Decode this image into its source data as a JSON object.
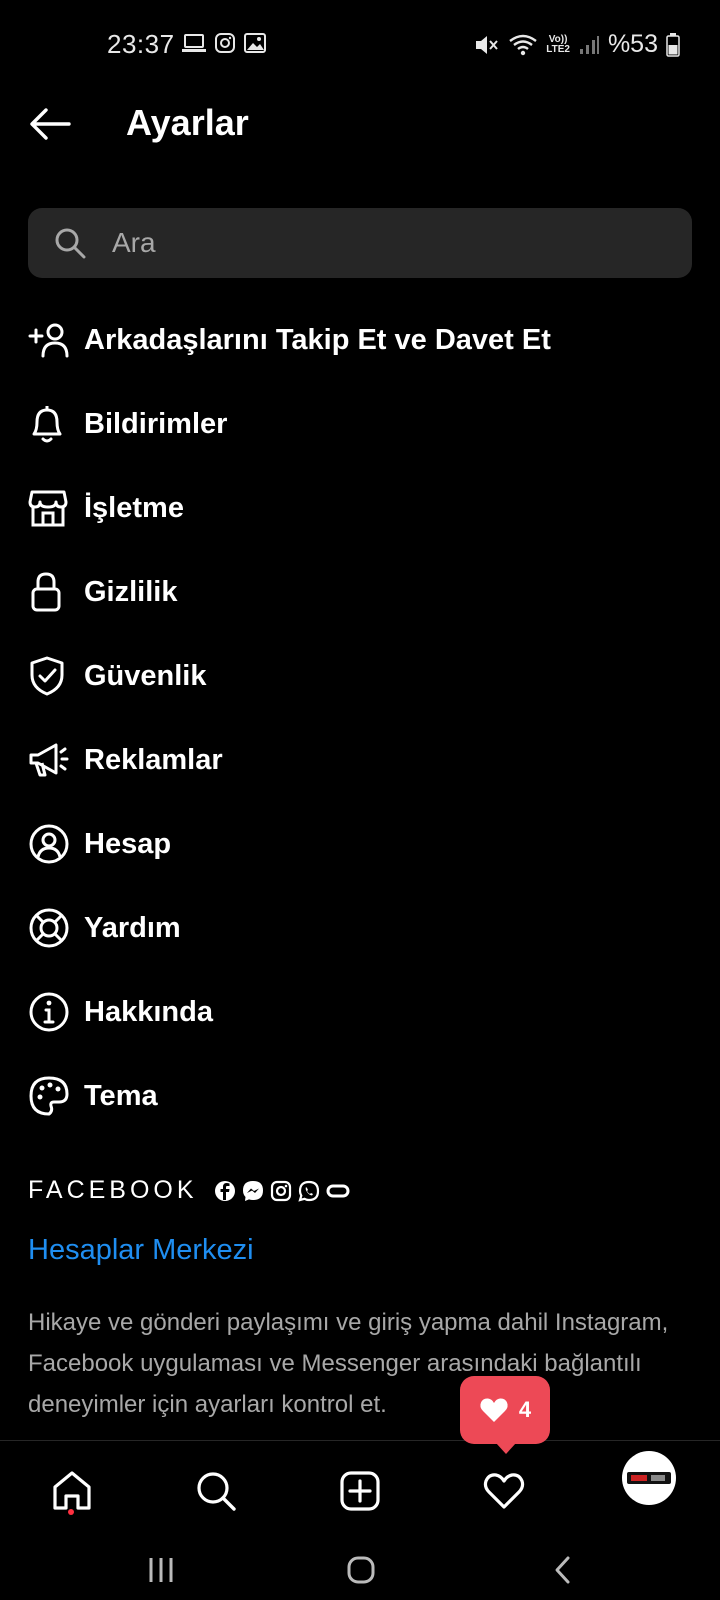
{
  "status": {
    "time": "23:37",
    "network": [
      "Vo))",
      "LTE2"
    ],
    "battery": "%53"
  },
  "header": {
    "title": "Ayarlar"
  },
  "search": {
    "placeholder": "Ara"
  },
  "menu": [
    {
      "label": "Arkadaşlarını Takip Et ve Davet Et",
      "icon": "add-person-icon"
    },
    {
      "label": "Bildirimler",
      "icon": "bell-icon"
    },
    {
      "label": "İşletme",
      "icon": "shop-icon"
    },
    {
      "label": "Gizlilik",
      "icon": "lock-icon"
    },
    {
      "label": "Güvenlik",
      "icon": "shield-check-icon"
    },
    {
      "label": "Reklamlar",
      "icon": "megaphone-icon"
    },
    {
      "label": "Hesap",
      "icon": "account-circle-icon"
    },
    {
      "label": "Yardım",
      "icon": "lifebuoy-icon"
    },
    {
      "label": "Hakkında",
      "icon": "info-icon"
    },
    {
      "label": "Tema",
      "icon": "palette-icon"
    }
  ],
  "facebook": {
    "title": "FACEBOOK",
    "accounts_center": "Hesaplar Merkezi",
    "description": "Hikaye ve gönderi paylaşımı ve giriş yapma dahil Instagram, Facebook uygulaması ve Messenger arasındaki bağlantılı deneyimler için ayarları kontrol et."
  },
  "notification": {
    "count": "4"
  },
  "colors": {
    "background": "#000000",
    "link": "#1f8ef1",
    "badge": "#ed4956",
    "muted": "#a8a8a8"
  }
}
